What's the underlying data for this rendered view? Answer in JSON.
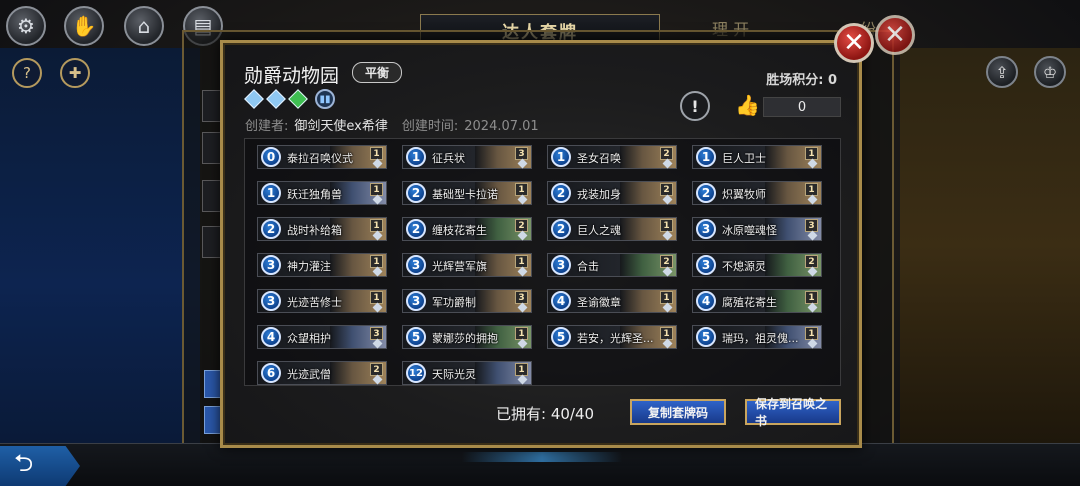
{
  "background": {
    "tab_title": "达人套牌",
    "tab_left_partial": "理 开",
    "tab_right_partial": "纷",
    "topbar_icons": [
      "gear-icon",
      "handshake-icon",
      "home-icon",
      "cards-icon"
    ],
    "left_small_icons": [
      "help-icon",
      "gift-icon"
    ],
    "right_icons": [
      "share-icon",
      "trophy-icon"
    ],
    "back_label": "⮌"
  },
  "dialog": {
    "title": "勋爵动物园",
    "badge": "平衡",
    "regions": [
      {
        "name": "light-blue-diamond",
        "color": "#8fc8f2"
      },
      {
        "name": "light-blue-diamond",
        "color": "#8fc8f2"
      },
      {
        "name": "green-diamond",
        "color": "#3fbf52"
      }
    ],
    "creator_label": "创建者:",
    "creator_name": "御剑天使ex希律",
    "created_label": "创建时间:",
    "created_date": "2024.07.01",
    "score_label": "胜场积分:",
    "score_value": "0",
    "likes": "0",
    "owned_label": "已拥有:",
    "owned_value": "40/40",
    "copy_button": "复制套牌码",
    "save_button": "保存到召唤之书",
    "close_symbol": "✕"
  },
  "cards": [
    {
      "cost": "0",
      "name": "泰拉召唤仪式",
      "count": "1",
      "art": "gold"
    },
    {
      "cost": "1",
      "name": "征兵状",
      "count": "3",
      "art": "gold"
    },
    {
      "cost": "1",
      "name": "圣女召唤",
      "count": "2",
      "art": "gold"
    },
    {
      "cost": "1",
      "name": "巨人卫士",
      "count": "1",
      "art": "gold"
    },
    {
      "cost": "1",
      "name": "跃迁独角兽",
      "count": "1",
      "art": "rare"
    },
    {
      "cost": "2",
      "name": "基础型卡拉诺",
      "count": "1",
      "art": "gold"
    },
    {
      "cost": "2",
      "name": "戎装加身",
      "count": "2",
      "art": "gold"
    },
    {
      "cost": "2",
      "name": "炽翼牧师",
      "count": "1",
      "art": "gold"
    },
    {
      "cost": "2",
      "name": "战时补给箱",
      "count": "1",
      "art": "gold"
    },
    {
      "cost": "2",
      "name": "缠枝花寄生",
      "count": "2",
      "art": "green"
    },
    {
      "cost": "2",
      "name": "巨人之魂",
      "count": "1",
      "art": "gold"
    },
    {
      "cost": "3",
      "name": "冰原噬魂怪",
      "count": "3",
      "art": "rare"
    },
    {
      "cost": "3",
      "name": "神力灌注",
      "count": "1",
      "art": "gold"
    },
    {
      "cost": "3",
      "name": "光辉营军旗",
      "count": "1",
      "art": "gold"
    },
    {
      "cost": "3",
      "name": "合击",
      "count": "2",
      "art": "green"
    },
    {
      "cost": "3",
      "name": "不熄源灵",
      "count": "2",
      "art": "green"
    },
    {
      "cost": "3",
      "name": "光迹苦修士",
      "count": "1",
      "art": "gold"
    },
    {
      "cost": "3",
      "name": "军功爵制",
      "count": "3",
      "art": "gold"
    },
    {
      "cost": "4",
      "name": "圣谕徽章",
      "count": "1",
      "art": "gold"
    },
    {
      "cost": "4",
      "name": "腐殖花寄生",
      "count": "1",
      "art": "green"
    },
    {
      "cost": "4",
      "name": "众望相护",
      "count": "3",
      "art": "rare"
    },
    {
      "cost": "5",
      "name": "蒙娜莎的拥抱",
      "count": "1",
      "art": "green"
    },
    {
      "cost": "5",
      "name": "若安，光辉圣...",
      "count": "1",
      "art": "gold"
    },
    {
      "cost": "5",
      "name": "瑞玛，祖灵傀...",
      "count": "1",
      "art": "rare"
    },
    {
      "cost": "6",
      "name": "光迹武僧",
      "count": "2",
      "art": "gold"
    },
    {
      "cost": "12",
      "name": "天际光灵",
      "count": "1",
      "art": "rare"
    }
  ]
}
